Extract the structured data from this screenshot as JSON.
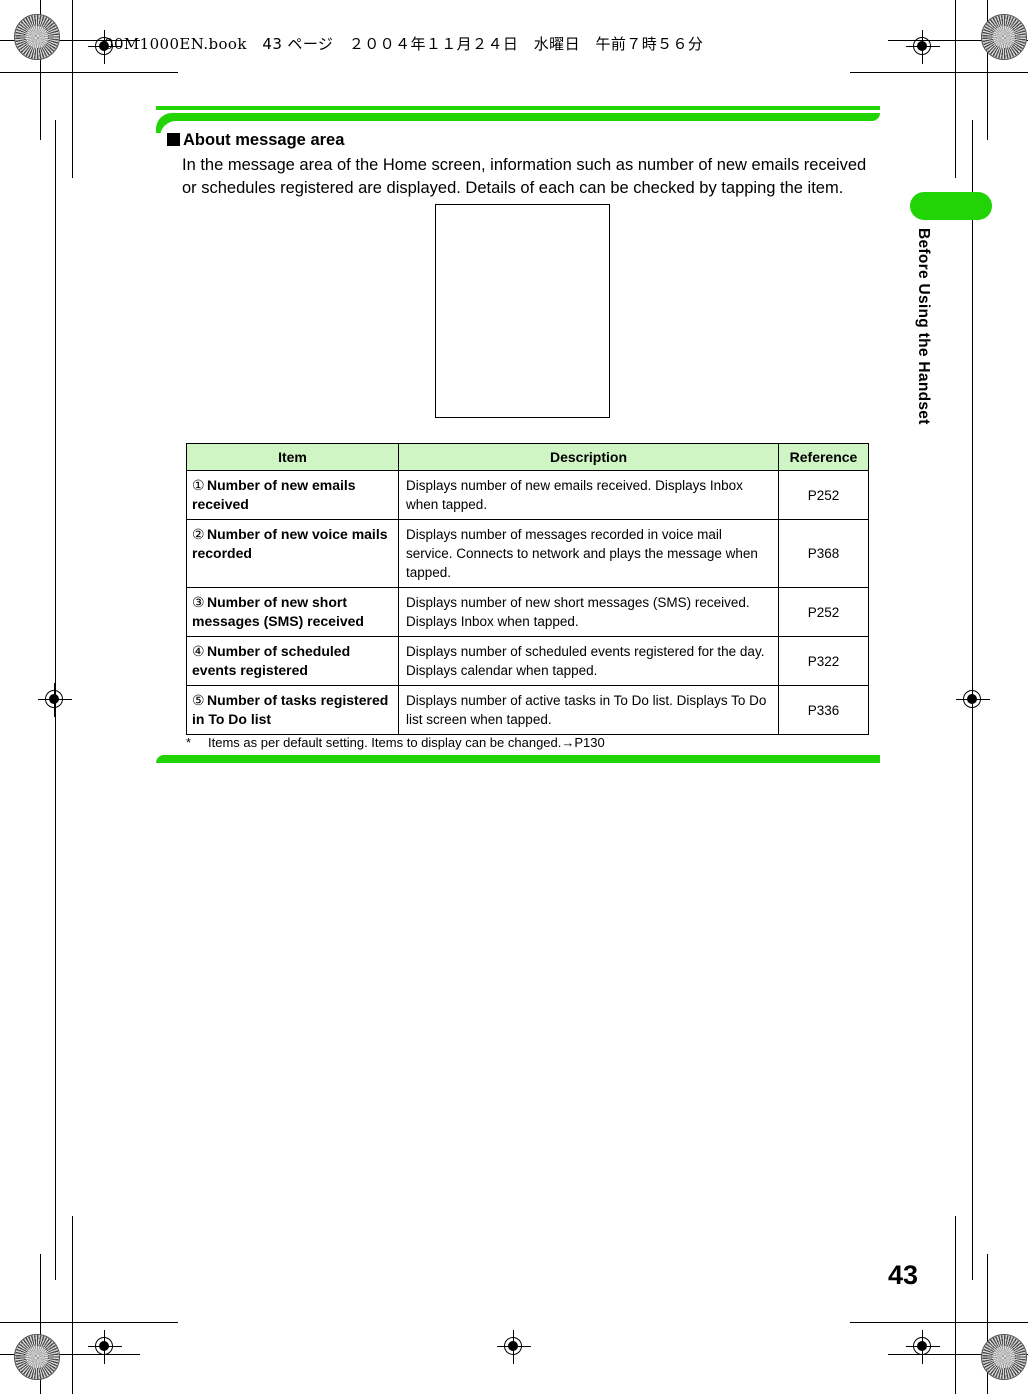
{
  "page_header": {
    "file": "00M1000EN.book",
    "page_ja": "43 ページ",
    "date_ja": "２００４年１１月２４日",
    "day_ja": "水曜日",
    "time_ja": "午前７時５６分"
  },
  "side_tab": {
    "label": "Before Using the Handset",
    "pill_color": "#22D406"
  },
  "section": {
    "heading": "About message area",
    "body": "In the message area of the Home screen, information such as number of new emails received or schedules registered are displayed. Details of each can be checked by tapping the item."
  },
  "figure": {
    "caption": ""
  },
  "table": {
    "headers": {
      "item": "Item",
      "description": "Description",
      "reference": "Reference"
    },
    "rows": [
      {
        "num": "①",
        "item": "Number of new emails received",
        "description": "Displays number of new emails received. Displays Inbox when tapped.",
        "reference": "P252"
      },
      {
        "num": "②",
        "item": "Number of new voice mails recorded",
        "description": "Displays number of messages recorded in voice mail service. Connects to network and plays the message when tapped.",
        "reference": "P368"
      },
      {
        "num": "③",
        "item": "Number of new short messages (SMS) received",
        "description": "Displays number of new short messages (SMS) received. Displays Inbox when tapped.",
        "reference": "P252"
      },
      {
        "num": "④",
        "item": "Number of scheduled events registered",
        "description": "Displays number of scheduled events registered for the day. Displays calendar when tapped.",
        "reference": "P322"
      },
      {
        "num": "⑤",
        "item": "Number of tasks registered in To Do list",
        "description": "Displays number of active tasks in To Do list. Displays To Do list screen when tapped.",
        "reference": "P336"
      }
    ]
  },
  "footnote": {
    "marker": "*",
    "text": "Items as per default setting. Items to display can be changed.→P130"
  },
  "folio": {
    "page_number": "43"
  },
  "colors": {
    "accent_green": "#22D406",
    "table_header_green": "#D0F5C4"
  }
}
